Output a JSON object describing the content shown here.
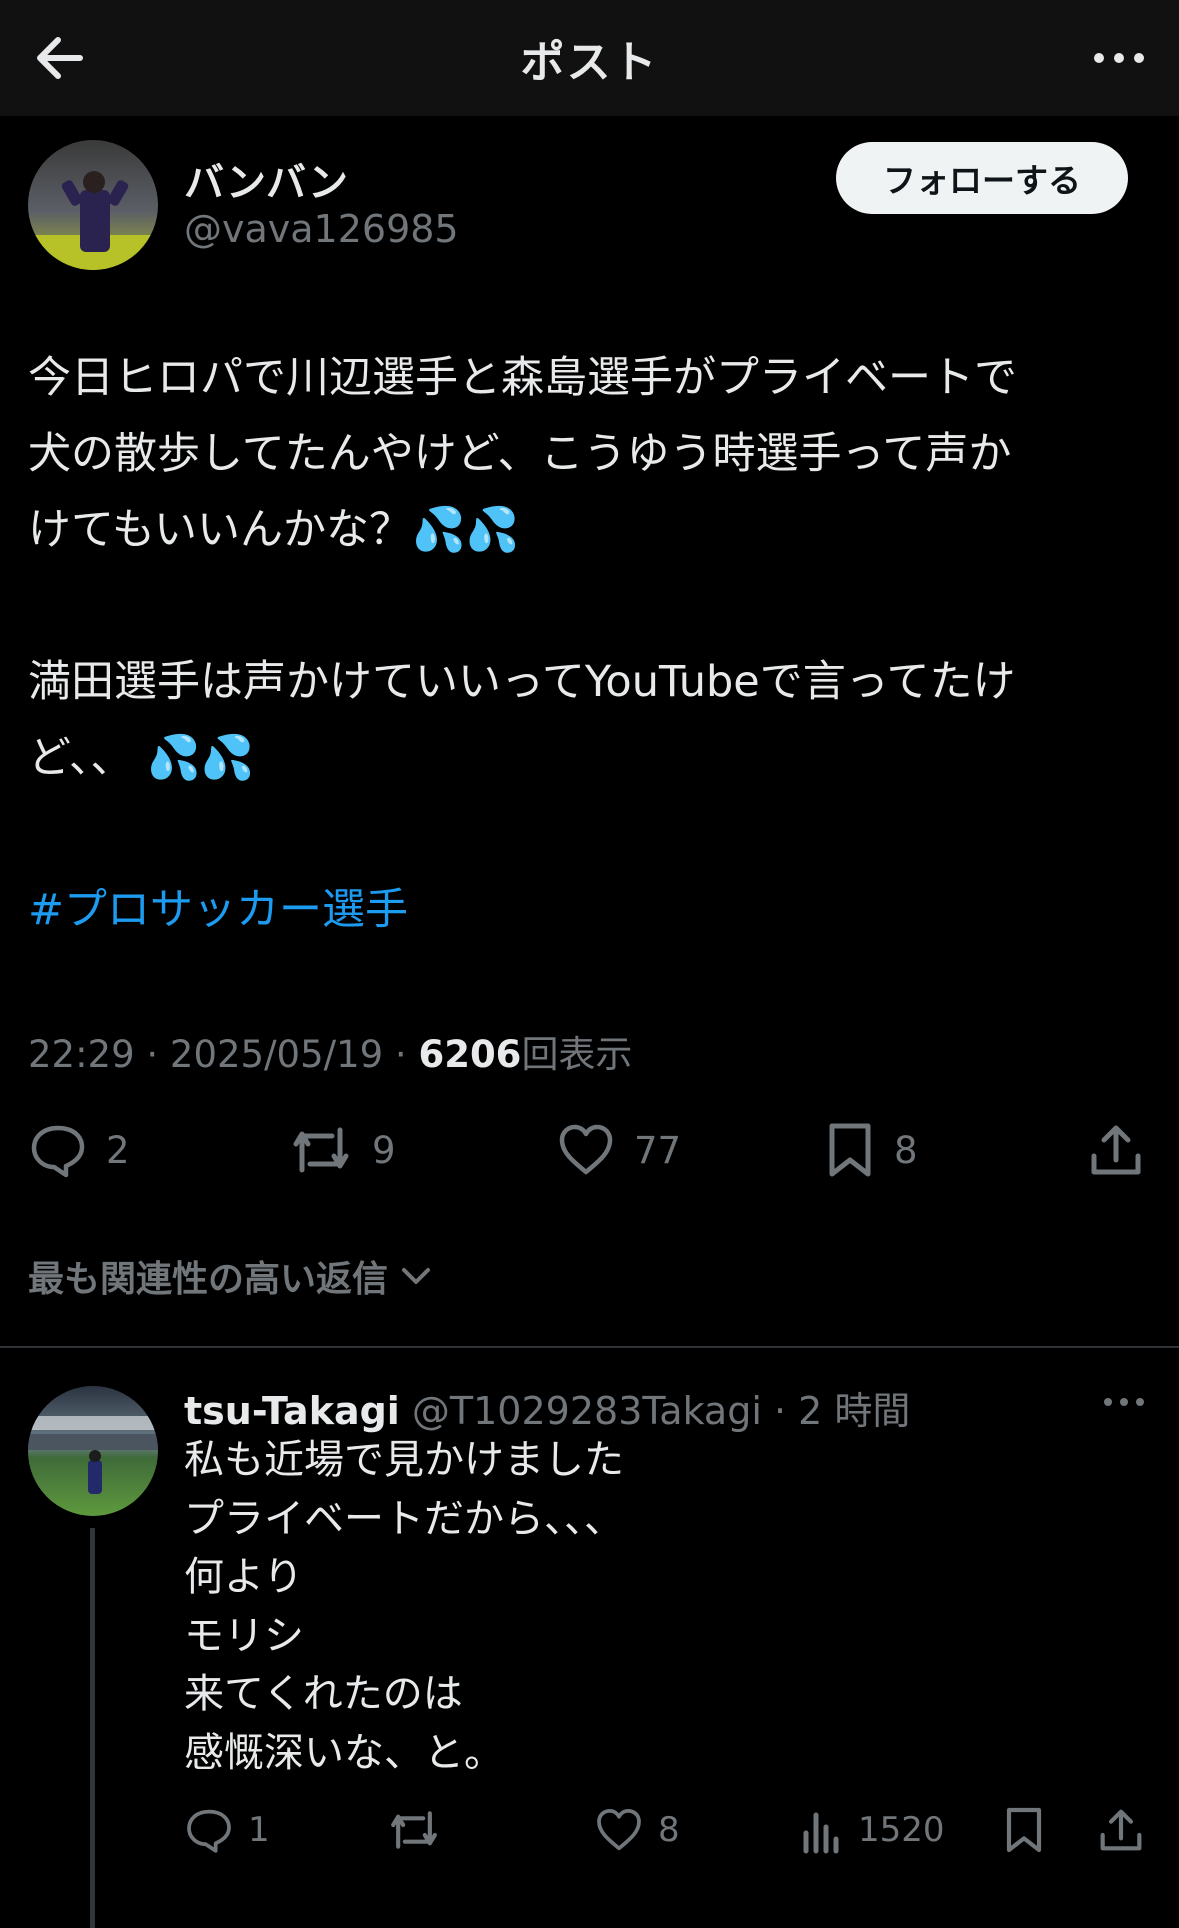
{
  "header": {
    "title": "ポスト",
    "back_icon": "arrow-left-icon",
    "more_icon": "more-horizontal-icon"
  },
  "post": {
    "author_name": "バンバン",
    "author_handle": "@vava126985",
    "follow_label": "フォローする",
    "text_lines": [
      "今日ヒロパで川辺選手と森島選手がプライベートで",
      "犬の散歩してたんやけど、こうゆう時選手って声か",
      "けてもいいんかな？💦💦",
      "",
      "満田選手は声かけていいってYouTubeで言ってたけ",
      "ど、、 💦💦",
      ""
    ],
    "hashtag": "#プロサッカー選手",
    "time": "22:29 · 2025/05/19 · ",
    "views": "6206",
    "views_label": "回表示",
    "stats": {
      "replies": "2",
      "reposts": "9",
      "likes": "77",
      "bookmarks": "8"
    }
  },
  "relevance_label": "最も関連性の高い返信",
  "reply": {
    "name": "tsu-Takagi",
    "handle": "@T1029283Takagi",
    "time": "· 2 時間",
    "text": "私も近場で見かけました\nプライベートだから、、、\n何より\nモリシ\n来てくれたのは\n感慨深いな、と。",
    "stats": {
      "replies": "1",
      "reposts": "",
      "likes": "8",
      "views": "1520"
    }
  },
  "colors": {
    "background": "#000000",
    "accent": "#1d9bf0",
    "muted": "#71767b"
  }
}
